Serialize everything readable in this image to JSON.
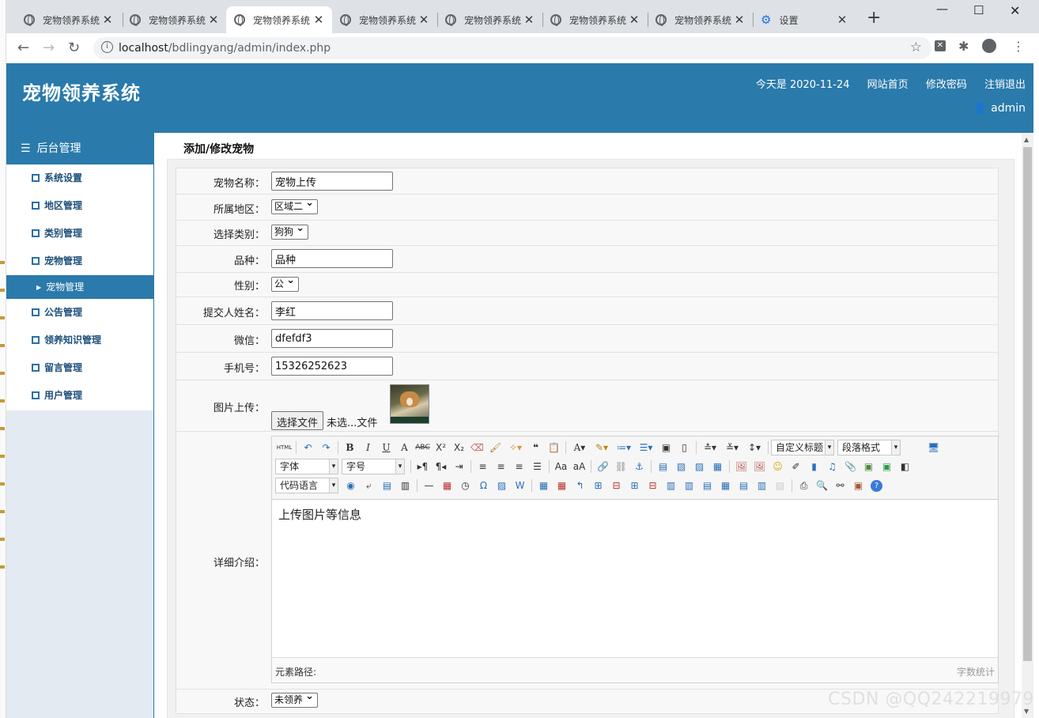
{
  "browser": {
    "tabs": [
      {
        "title": "宠物领养系统"
      },
      {
        "title": "宠物领养系统"
      },
      {
        "title": "宠物领养系统"
      },
      {
        "title": "宠物领养系统"
      },
      {
        "title": "宠物领养系统"
      },
      {
        "title": "宠物领养系统"
      },
      {
        "title": "宠物领养系统"
      },
      {
        "title": "设置"
      }
    ],
    "url_host": "localhost",
    "url_path": "/bdlingyang/admin/index.php"
  },
  "header": {
    "logo": "宠物领养系统",
    "date": "今天是 2020-11-24",
    "link_home": "网站首页",
    "link_password": "修改密码",
    "link_logout": "注销退出",
    "user": "admin"
  },
  "sidebar": {
    "title": "后台管理",
    "items": [
      {
        "label": "系统设置"
      },
      {
        "label": "地区管理"
      },
      {
        "label": "类别管理"
      },
      {
        "label": "宠物管理"
      }
    ],
    "sub_active": "宠物管理",
    "items2": [
      {
        "label": "公告管理"
      },
      {
        "label": "领养知识管理"
      },
      {
        "label": "留言管理"
      },
      {
        "label": "用户管理"
      }
    ]
  },
  "page": {
    "title": "添加/修改宠物"
  },
  "form": {
    "name_label": "宠物名称：",
    "name_value": "宠物上传",
    "region_label": "所属地区：",
    "region_value": "区域二",
    "category_label": "选择类别：",
    "category_value": "狗狗",
    "breed_label": "品种：",
    "breed_value": "品种",
    "gender_label": "性别：",
    "gender_value": "公",
    "submitter_label": "提交人姓名：",
    "submitter_value": "李红",
    "wechat_label": "微信：",
    "wechat_value": "dfefdf3",
    "phone_label": "手机号：",
    "phone_value": "15326252623",
    "image_label": "图片上传：",
    "file_button": "选择文件",
    "file_status": "未选...文件",
    "detail_label": "详细介绍：",
    "status_label": "状态：",
    "status_value": "未领养"
  },
  "editor": {
    "custom_heading": "自定义标题",
    "paragraph_format": "段落格式",
    "font_family": "字体",
    "font_size": "字号",
    "code_language": "代码语言",
    "content": "上传图片等信息",
    "element_path": "元素路径:",
    "word_count": "字数统计"
  },
  "watermark": "CSDN @QQ242219979"
}
